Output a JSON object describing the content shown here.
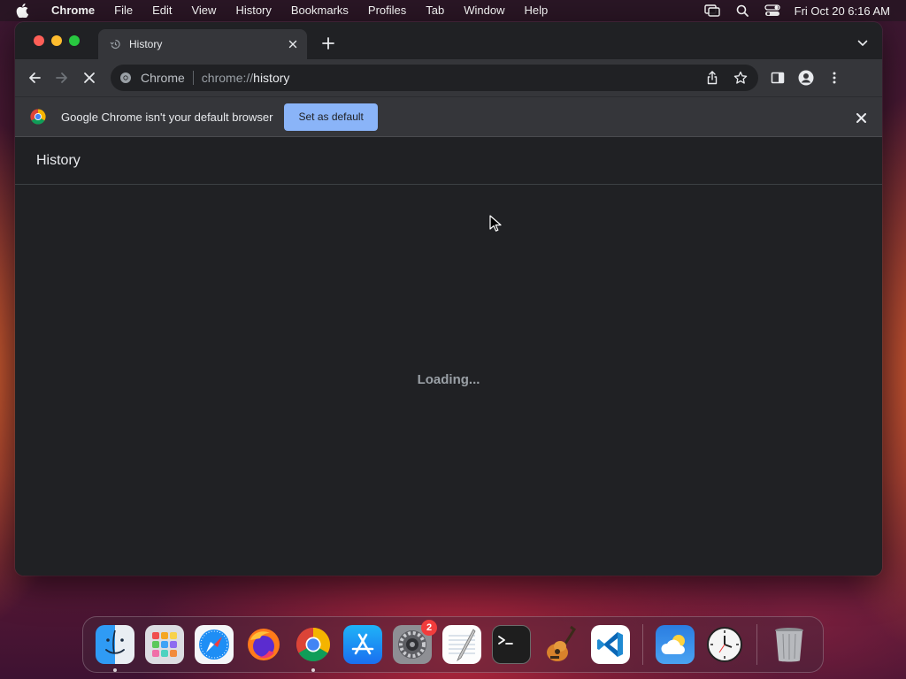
{
  "menubar": {
    "app_name": "Chrome",
    "items": [
      "File",
      "Edit",
      "View",
      "History",
      "Bookmarks",
      "Profiles",
      "Tab",
      "Window",
      "Help"
    ],
    "clock": "Fri Oct 20  6:16 AM"
  },
  "window": {
    "tab": {
      "title": "History"
    },
    "omnibox": {
      "chip": "Chrome",
      "url_scheme": "chrome://",
      "url_host": "history"
    },
    "infobar": {
      "message": "Google Chrome isn't your default browser",
      "button": "Set as default"
    },
    "page": {
      "title": "History",
      "loading": "Loading..."
    }
  },
  "dock": {
    "apps": [
      {
        "name": "Finder",
        "running": true
      },
      {
        "name": "Launchpad"
      },
      {
        "name": "Safari"
      },
      {
        "name": "Firefox"
      },
      {
        "name": "Google Chrome",
        "running": true
      },
      {
        "name": "App Store"
      },
      {
        "name": "System Settings",
        "badge": "2"
      },
      {
        "name": "TextEdit"
      },
      {
        "name": "Terminal"
      },
      {
        "name": "GarageBand"
      },
      {
        "name": "Visual Studio Code"
      },
      {
        "name": "Weather"
      },
      {
        "name": "Clock"
      },
      {
        "name": "Trash"
      }
    ],
    "settings_badge": "2"
  },
  "colors": {
    "window_bg": "#202124",
    "toolbar_bg": "#35363a",
    "accent_button": "#8ab4f8",
    "text_primary": "#e8eaed",
    "text_secondary": "#9aa0a6"
  }
}
